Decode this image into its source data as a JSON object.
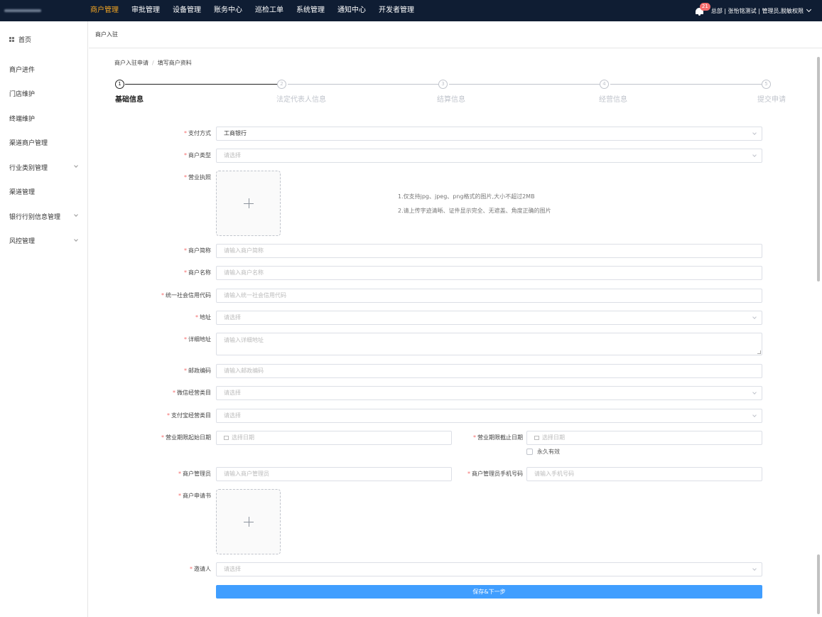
{
  "topbar": {
    "nav": [
      "商户管理",
      "审批管理",
      "设备管理",
      "账务中心",
      "巡检工单",
      "系统管理",
      "通知中心",
      "开发者管理"
    ],
    "active_nav": "商户管理",
    "notification_count": "21",
    "user_info": "总部 | 张怡铭测试 | 管理员,脱敏权限"
  },
  "sidebar": {
    "items": [
      {
        "label": "首页"
      },
      {
        "label": "商户进件"
      },
      {
        "label": "门店维护"
      },
      {
        "label": "终端维护"
      },
      {
        "label": "渠道商户管理"
      },
      {
        "label": "行业类别管理"
      },
      {
        "label": "渠道管理"
      },
      {
        "label": "银行行别信息管理"
      },
      {
        "label": "风控管理"
      }
    ]
  },
  "tab": {
    "label": "商户入驻"
  },
  "breadcrumb": {
    "first": "商户入驻申请",
    "sep": "/",
    "second": "填写商户资料"
  },
  "steps": [
    {
      "num": "1",
      "label": "基础信息"
    },
    {
      "num": "2",
      "label": "法定代表人信息"
    },
    {
      "num": "3",
      "label": "结算信息"
    },
    {
      "num": "4",
      "label": "经营信息"
    },
    {
      "num": "5",
      "label": "提交申请"
    }
  ],
  "form": {
    "pay_method": {
      "label": "支付方式",
      "value": "工商银行"
    },
    "merchant_type": {
      "label": "商户类型",
      "placeholder": "请选择"
    },
    "license": {
      "label": "营业执照",
      "hint1": "1.仅支持jpg、jpeg、png格式的图片,大小不超过2MB",
      "hint2": "2.请上传字迹清晰、证件显示完全、无遮盖、角度正确的图片"
    },
    "short_name": {
      "label": "商户简称",
      "placeholder": "请输入商户简称"
    },
    "full_name": {
      "label": "商户名称",
      "placeholder": "请输入商户名称"
    },
    "credit_code": {
      "label": "统一社会信用代码",
      "placeholder": "请输入统一社会信用代码"
    },
    "address": {
      "label": "地址",
      "placeholder": "请选择"
    },
    "detail_address": {
      "label": "详细地址",
      "placeholder": "请输入详细地址"
    },
    "postcode": {
      "label": "邮政编码",
      "placeholder": "请输入邮政编码"
    },
    "wechat_category": {
      "label": "微信经营类目",
      "placeholder": "请选择"
    },
    "alipay_category": {
      "label": "支付宝经营类目",
      "placeholder": "请选择"
    },
    "start_date": {
      "label": "营业期限起始日期",
      "placeholder": "选择日期"
    },
    "end_date": {
      "label": "营业期限截止日期",
      "placeholder": "选择日期"
    },
    "permanent": {
      "label": "永久有效"
    },
    "admin": {
      "label": "商户管理员",
      "placeholder": "请输入商户管理员"
    },
    "admin_phone": {
      "label": "商户管理员手机号码",
      "placeholder": "请输入手机号码"
    },
    "application": {
      "label": "商户申请书"
    },
    "inviter": {
      "label": "邀请人",
      "placeholder": "请选择"
    },
    "submit_label": "保存&下一步"
  },
  "required_mark": "*"
}
